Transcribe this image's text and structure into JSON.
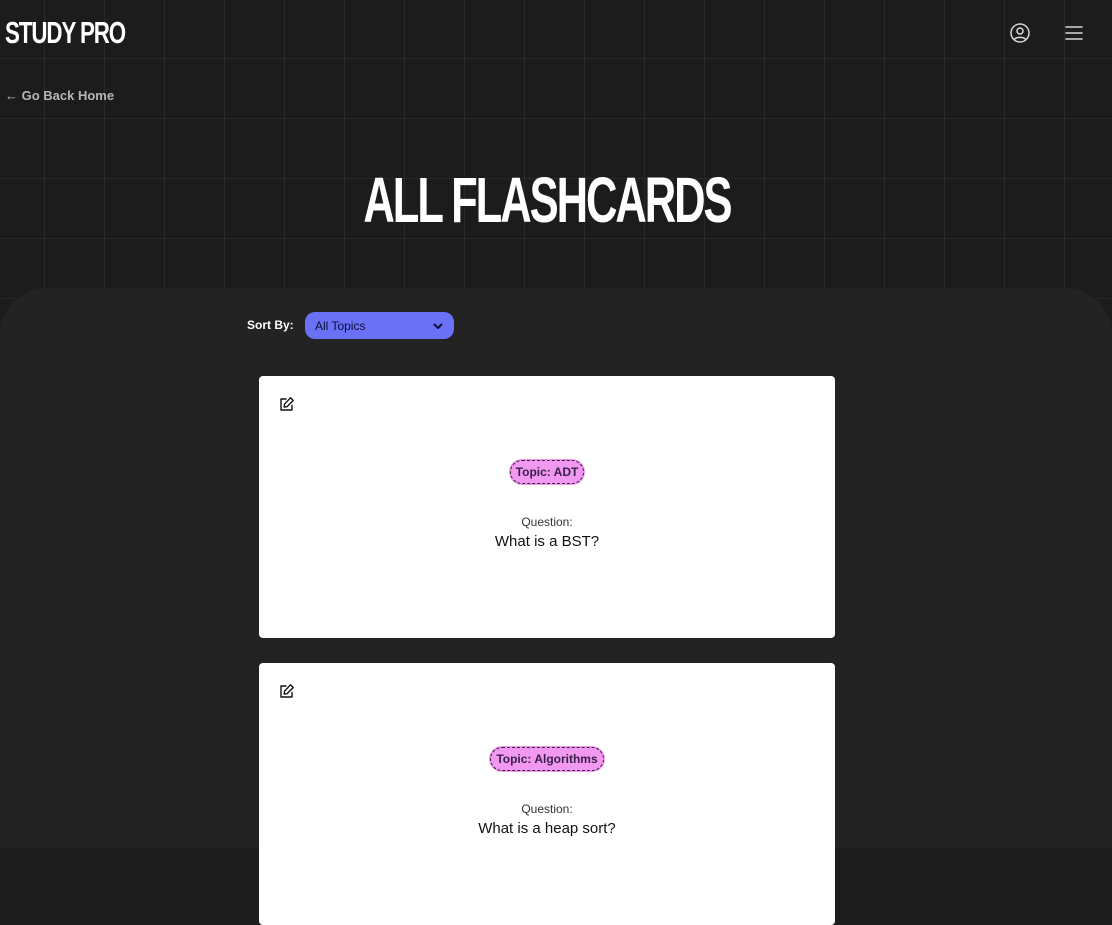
{
  "header": {
    "brand": "STUDY PRO",
    "account_icon": "user-circle-icon",
    "menu_icon": "hamburger-menu-icon"
  },
  "nav": {
    "back_label": "← Go Back Home"
  },
  "page": {
    "title": "ALL FLASHCARDS"
  },
  "sort": {
    "label": "Sort By:",
    "selected": "All Topics",
    "accent": "#6a71f6"
  },
  "cards": [
    {
      "topic": "Topic: ADT",
      "question_label": "Question:",
      "question": "What is a BST?"
    },
    {
      "topic": "Topic: Algorithms",
      "question_label": "Question:",
      "question": "What is a heap sort?"
    }
  ],
  "colors": {
    "background": "#1c1c1c",
    "panel": "#232323",
    "card": "#ffffff",
    "topic_badge": "#f199f0"
  }
}
